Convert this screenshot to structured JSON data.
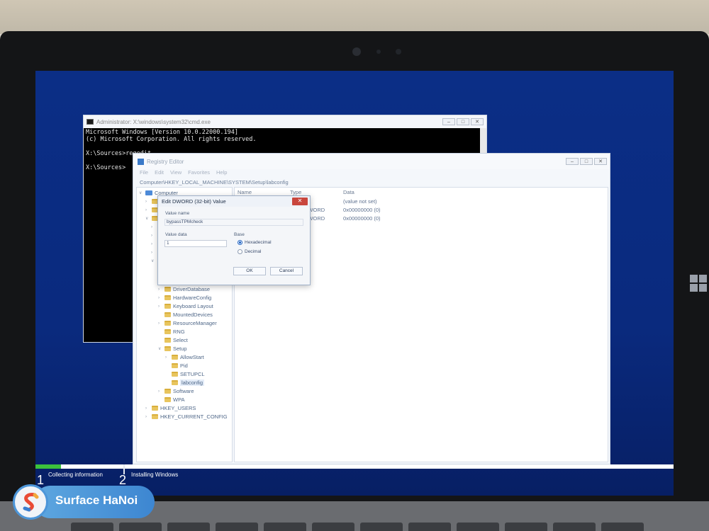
{
  "cmd": {
    "title": "Administrator: X:\\windows\\system32\\cmd.exe",
    "lines": [
      "Microsoft Windows [Version 10.0.22000.194]",
      "(c) Microsoft Corporation. All rights reserved.",
      "",
      "X:\\Sources>regedit",
      "",
      "X:\\Sources>"
    ]
  },
  "regedit": {
    "title": "Registry Editor",
    "menu": [
      "File",
      "Edit",
      "View",
      "Favorites",
      "Help"
    ],
    "address": "Computer\\HKEY_LOCAL_MACHINE\\SYSTEM\\Setup\\labconfig",
    "tree": {
      "root": "Computer",
      "items": [
        "DriverDatabase",
        "HardwareConfig",
        "Keyboard Layout",
        "MountedDevices",
        "ResourceManager",
        "RNG",
        "Select",
        "Setup",
        "AllowStart",
        "Pid",
        "SETUPCL",
        "labconfig",
        "Software",
        "WPA",
        "HKEY_USERS",
        "HKEY_CURRENT_CONFIG"
      ]
    },
    "columns": {
      "name": "Name",
      "type": "Type",
      "data": "Data"
    },
    "rows": [
      {
        "type": "",
        "data": "(value not set)"
      },
      {
        "type": "DWORD",
        "data": "0x00000000 (0)"
      },
      {
        "type": "DWORD",
        "data": "0x00000000 (0)"
      }
    ]
  },
  "dialog": {
    "title": "Edit DWORD (32-bit) Value",
    "value_name_label": "Value name",
    "value_name": "bypassTPMcheck",
    "value_data_label": "Value data",
    "value_data": "1",
    "base_label": "Base",
    "hex_label": "Hexadecimal",
    "dec_label": "Decimal",
    "ok": "OK",
    "cancel": "Cancel"
  },
  "setup": {
    "step1": "Collecting information",
    "step2": "Installing Windows",
    "progress": 0.04
  },
  "overlay": {
    "num1": "1",
    "num2": "2",
    "brand": "Surface HaNoi"
  }
}
